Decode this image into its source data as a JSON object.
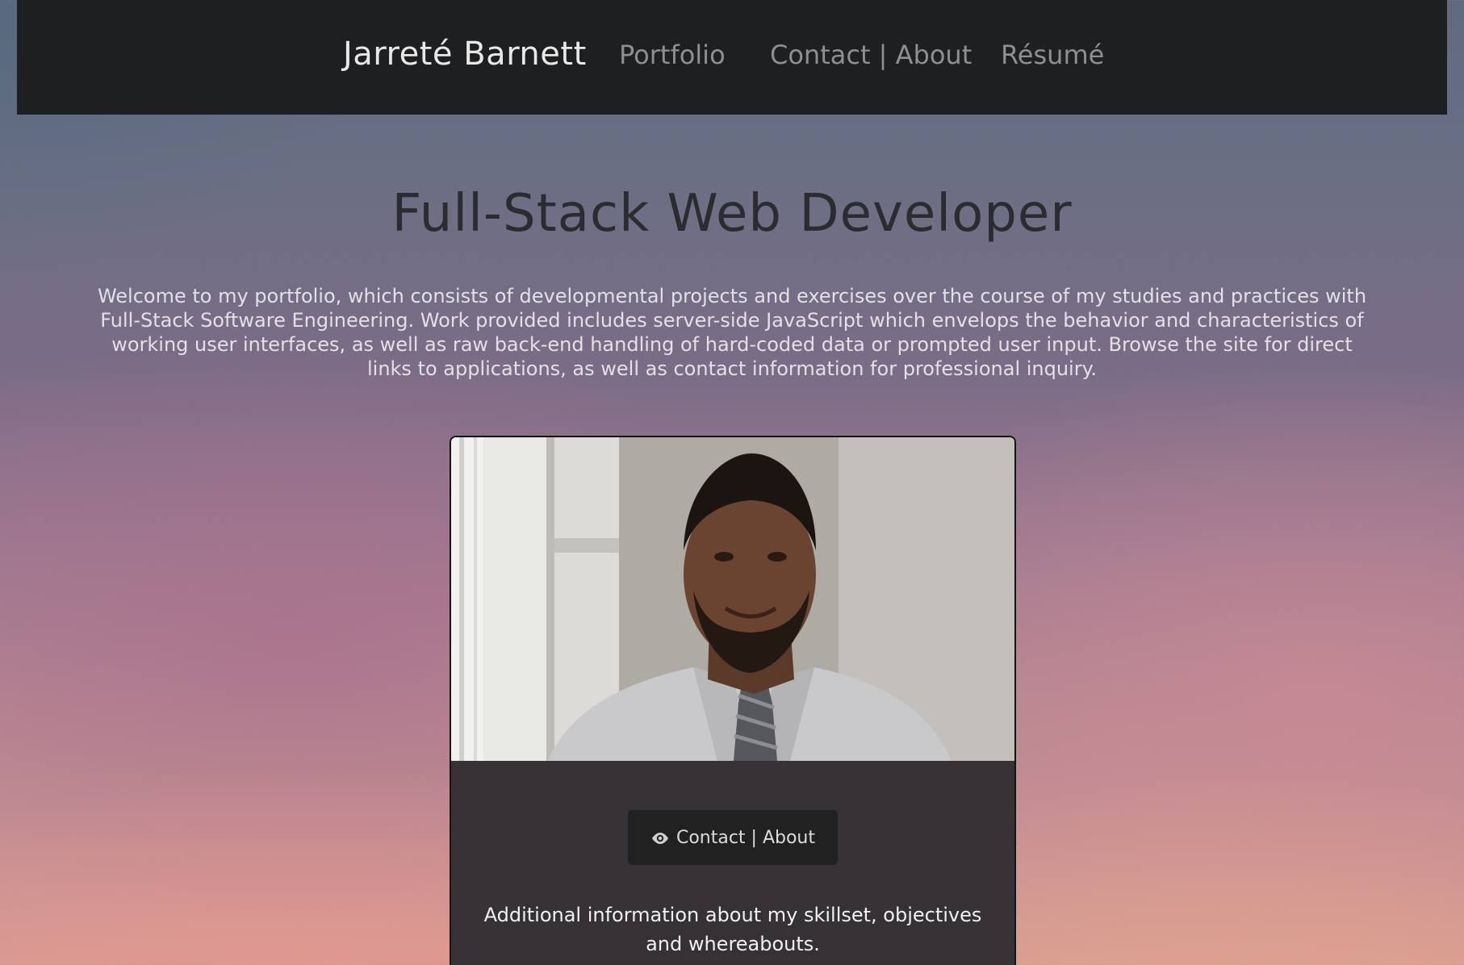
{
  "navbar": {
    "brand": "Jarreté Barnett",
    "links": [
      {
        "label": "Portfolio"
      },
      {
        "label": "Contact | About"
      },
      {
        "label": "Résumé"
      }
    ]
  },
  "hero": {
    "title": "Full-Stack Web Developer",
    "intro": "Welcome to my portfolio, which consists of developmental projects and exercises over the course of my studies and practices with Full-Stack Software Engineering. Work provided includes server-side JavaScript which envelops the behavior and characteristics of working user interfaces, as well as raw back-end handling of hard-coded data or prompted user input. Browse the site for direct links to applications, as well as contact information for professional inquiry."
  },
  "card": {
    "button_label": "Contact | About",
    "button_icon": "eye-icon",
    "text": "Additional information about my skillset, objectives and whereabouts."
  },
  "colors": {
    "navbar_bg": "#1e1f21",
    "card_bg": "#353135",
    "button_bg": "#212121",
    "title_text": "#2a2c30"
  }
}
